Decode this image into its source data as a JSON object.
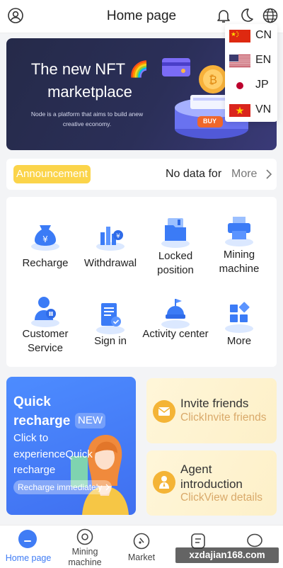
{
  "header": {
    "title": "Home page",
    "icons": [
      "user-icon",
      "bell-icon",
      "moon-icon",
      "globe-icon"
    ]
  },
  "language_menu": {
    "items": [
      {
        "code": "CN",
        "flag": "china-flag-icon"
      },
      {
        "code": "EN",
        "flag": "usa-flag-icon"
      },
      {
        "code": "JP",
        "flag": "japan-flag-icon"
      },
      {
        "code": "VN",
        "flag": "vietnam-flag-icon"
      }
    ]
  },
  "banner": {
    "title": "The new NFT 🌈 marketplace",
    "subtitle": "Node is a platform that aims to build anew creative economy.",
    "buy_label": "BUY"
  },
  "announcement": {
    "badge": "Announcement",
    "text": "No data for",
    "more": "More"
  },
  "grid": {
    "items": [
      {
        "label": "Recharge",
        "icon": "money-bag-icon"
      },
      {
        "label": "Withdrawal",
        "icon": "bar-chart-yen-icon"
      },
      {
        "label": "Locked position",
        "icon": "folder-icon"
      },
      {
        "label": "Mining machine",
        "icon": "printer-icon"
      },
      {
        "label": "Customer Service",
        "icon": "customer-service-icon"
      },
      {
        "label": "Sign in",
        "icon": "clipboard-check-icon"
      },
      {
        "label": "Activity center",
        "icon": "activity-icon"
      },
      {
        "label": "More",
        "icon": "grid-more-icon"
      }
    ]
  },
  "quick_recharge": {
    "title": "Quick recharge",
    "badge": "NEW",
    "description": "Click to experienceQuick recharge",
    "button": "Recharge immediately"
  },
  "invite": {
    "title": "Invite friends",
    "subtitle": "ClickInvite friends"
  },
  "agent": {
    "title": "Agent introduction",
    "subtitle": "ClickView details"
  },
  "tabbar": {
    "items": [
      {
        "label": "Home page",
        "active": true
      },
      {
        "label": "Mining machine",
        "active": false
      },
      {
        "label": "Market",
        "active": false
      },
      {
        "label": "",
        "active": false
      },
      {
        "label": "",
        "active": false
      }
    ]
  },
  "watermark": "xzdajian168.com",
  "colors": {
    "accent": "#3f7cf5",
    "announcement_badge": "#fbd44a",
    "banner_bg": "#252a49",
    "card_gold": "#d9a96a"
  }
}
